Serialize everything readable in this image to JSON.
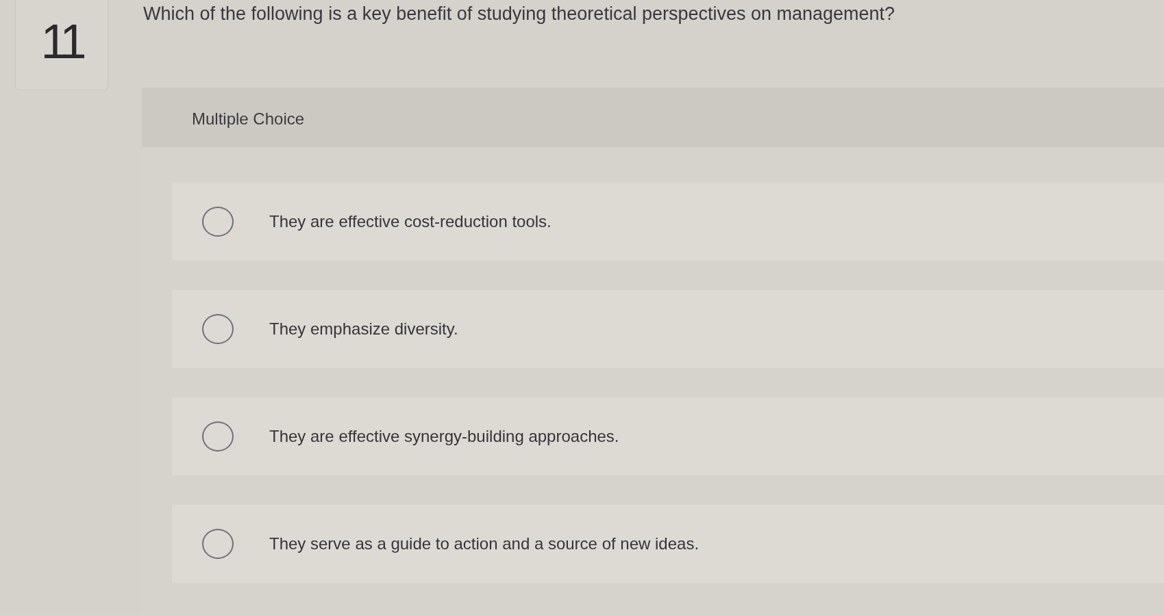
{
  "question": {
    "number": "11",
    "text": "Which of the following is a key benefit of studying theoretical perspectives on management?"
  },
  "answer_area": {
    "type_label": "Multiple Choice",
    "options": [
      {
        "text": "They are effective cost-reduction tools.",
        "selected": false
      },
      {
        "text": "They emphasize diversity.",
        "selected": false
      },
      {
        "text": "They are effective synergy-building approaches.",
        "selected": false
      },
      {
        "text": "They serve as a guide to action and a source of new ideas.",
        "selected": false
      }
    ]
  }
}
